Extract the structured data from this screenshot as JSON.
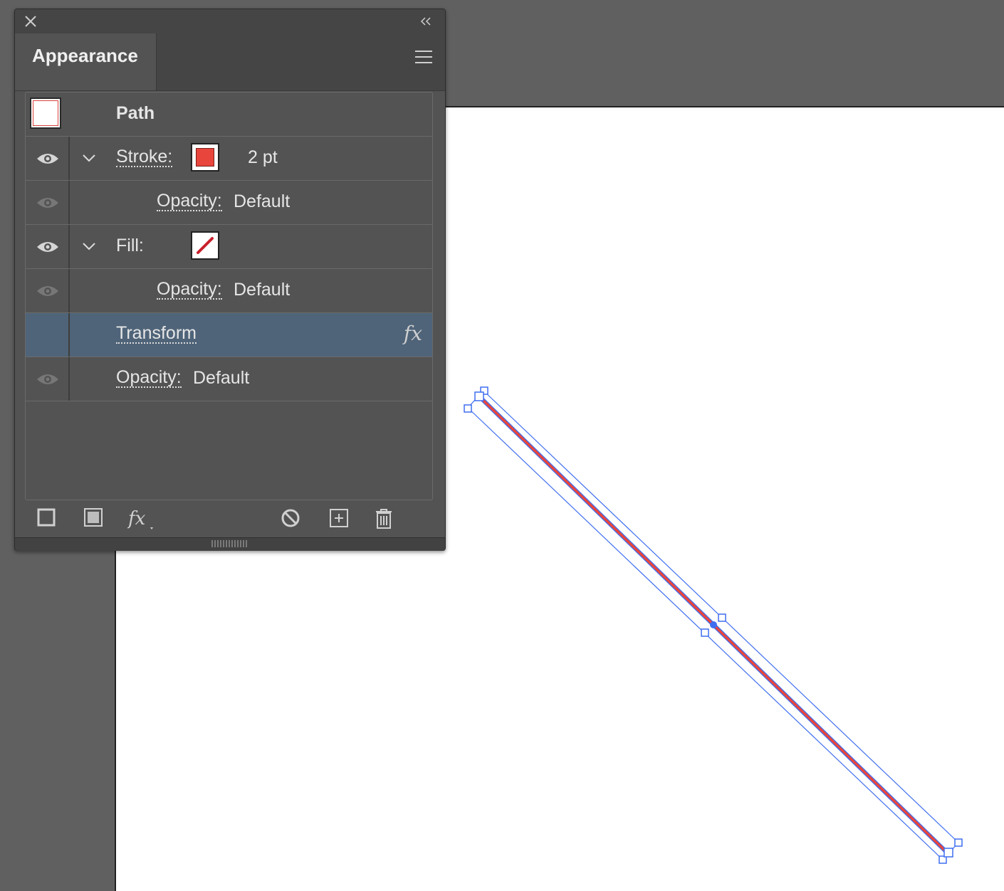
{
  "panel": {
    "tab_label": "Appearance",
    "rows": {
      "path": {
        "label": "Path"
      },
      "stroke": {
        "label": "Stroke:",
        "weight": "2 pt",
        "color": "#e8453c"
      },
      "stroke_opacity": {
        "label": "Opacity:",
        "value": "Default"
      },
      "fill": {
        "label": "Fill:",
        "color": "none"
      },
      "fill_opacity": {
        "label": "Opacity:",
        "value": "Default"
      },
      "transform": {
        "label": "Transform"
      },
      "opacity": {
        "label": "Opacity:",
        "value": "Default"
      }
    }
  },
  "icons": {
    "close": "close-icon",
    "collapse": "double-chevron-left-icon",
    "menu": "hamburger-menu-icon",
    "eye": "eye-icon",
    "disclosure": "chevron-down-icon",
    "fx": "fx-icon",
    "add_stroke": "add-stroke-icon",
    "add_fill": "add-fill-icon",
    "add_effect": "fx-menu-icon",
    "clear": "clear-appearance-icon",
    "duplicate": "duplicate-item-icon",
    "delete": "trash-icon"
  },
  "colors": {
    "ui_bg": "#606060",
    "panel_bg": "#535353",
    "selection": "#4f6479",
    "line_stroke": "#e8453c",
    "selection_blue": "#3f6ff0"
  }
}
